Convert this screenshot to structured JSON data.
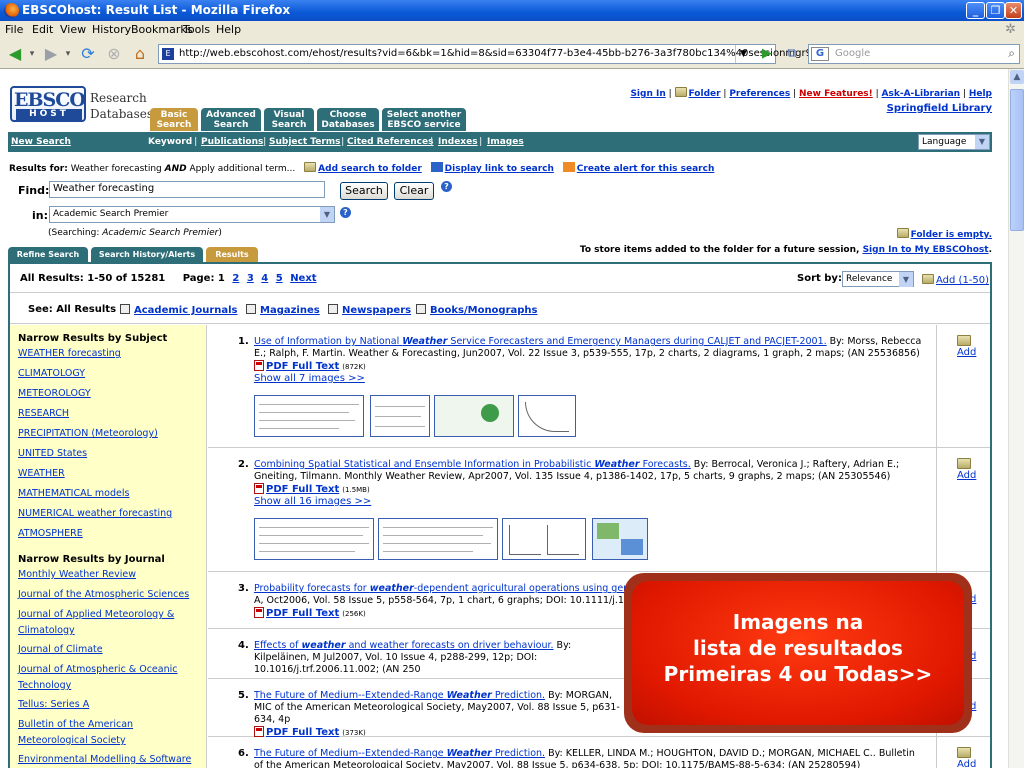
{
  "window": {
    "title": "EBSCOhost: Result List - Mozilla Firefox"
  },
  "menu": [
    "File",
    "Edit",
    "View",
    "History",
    "Bookmarks",
    "Tools",
    "Help"
  ],
  "nav": {
    "url": "http://web.ebscohost.com/ehost/results?vid=6&bk=1&hid=8&sid=63304f77-b3e4-45bb-b276-3a3f780bc134%40sessionmgr9",
    "search_placeholder": "Google"
  },
  "brand": {
    "logo_top": "EBSCO",
    "logo_bottom": "HOST",
    "line1": "Research",
    "line2": "Databases"
  },
  "tabs": [
    {
      "label": "Basic Search"
    },
    {
      "label": "Advanced Search"
    },
    {
      "label": "Visual Search"
    },
    {
      "label": "Choose Databases"
    },
    {
      "label": "Select another EBSCO service"
    }
  ],
  "toplinks": {
    "sign_in": "Sign In",
    "folder": "Folder",
    "preferences": "Preferences",
    "new_features": "New Features!",
    "ask": "Ask-A-Librarian",
    "help": "Help",
    "library": "Springfield Library"
  },
  "greenbar": {
    "new_search": "New Search",
    "keyword": "Keyword",
    "publications": "Publications",
    "subject_terms": "Subject Terms",
    "cited_references": "Cited References",
    "indexes": "Indexes",
    "images": "Images",
    "language": "Language"
  },
  "results_for": {
    "label": "Results for:",
    "query_start": "Weather forecasting",
    "and": "AND",
    "query_end": "Apply additional term...",
    "add_folder": "Add search to folder",
    "display_link": "Display link to search",
    "create_alert": "Create alert for this search"
  },
  "find": {
    "label": "Find:",
    "value": "Weather forecasting",
    "search_button": "Search",
    "clear_button": "Clear"
  },
  "in": {
    "label": "in:",
    "value": "Academic Search Premier",
    "searching_label": "Searching:",
    "searching_value": "Academic Search Premier"
  },
  "folder_status": "Folder is empty.",
  "store": {
    "text": "To store items added to the folder for a future session,",
    "link": "Sign In to My EBSCOhost"
  },
  "result_tabs": [
    "Refine Search",
    "Search History/Alerts",
    "Results"
  ],
  "pagination": {
    "summary": "All Results: 1-50 of 15281",
    "page_label": "Page: 1",
    "pages": [
      "2",
      "3",
      "4",
      "5"
    ],
    "next": "Next"
  },
  "sort": {
    "label": "Sort by:",
    "value": "Relevance",
    "add": "Add (1-50)"
  },
  "see": {
    "label": "See: All Results",
    "types": [
      "Academic Journals",
      "Magazines",
      "Newspapers",
      "Books/Monographs"
    ]
  },
  "sidebar": {
    "subject_heading": "Narrow Results by Subject",
    "subjects": [
      "WEATHER forecasting",
      "CLIMATOLOGY",
      "METEOROLOGY",
      "RESEARCH",
      "PRECIPITATION (Meteorology)",
      "UNITED States",
      "WEATHER",
      "MATHEMATICAL models",
      "NUMERICAL weather forecasting",
      "ATMOSPHERE"
    ],
    "journal_heading": "Narrow Results by Journal",
    "journals": [
      "Monthly Weather Review",
      "Journal of the Atmospheric Sciences",
      "Journal of Applied Meteorology & Climatology",
      "Journal of Climate",
      "Journal of Atmospheric & Oceanic Technology",
      "Tellus: Series A",
      "Bulletin of the American Meteorological Society",
      "Environmental Modelling & Software"
    ]
  },
  "results": [
    {
      "num": "1.",
      "title_a": "Use of Information by National ",
      "title_w": "Weather",
      "title_b": " Service Forecasters and Emergency Managers during CALJET and PACJET-2001.",
      "meta": " By: Morss, Rebecca E.; Ralph, F. Martin. Weather & Forecasting, Jun2007, Vol. 22 Issue 3, p539-555, 17p, 2 charts, 2 diagrams, 1 graph, 2 maps; (AN 25536856)",
      "pdf": "PDF Full Text",
      "size": "(872K)",
      "show": "Show all 7 images >>",
      "add": "Add"
    },
    {
      "num": "2.",
      "title_a": "Combining Spatial Statistical and Ensemble Information in Probabilistic ",
      "title_w": "Weather",
      "title_b": " Forecasts.",
      "meta": " By: Berrocal, Veronica J.; Raftery, Adrian E.; Gneiting, Tilmann. Monthly Weather Review, Apr2007, Vol. 135 Issue 4, p1386-1402, 17p, 5 charts, 9 graphs, 2 maps; (AN 25305546)",
      "pdf": "PDF Full Text",
      "size": "(1.5MB)",
      "show": "Show all 16 images >>",
      "add": "Add"
    },
    {
      "num": "3.",
      "title_a": "Probability forecasts for ",
      "title_w": "weather",
      "title_b": "-dependent agricultural operations using generali",
      "meta": "A, Oct2006, Vol. 58 Issue 5, p558-564, 7p, 1 chart, 6 graphs; DOI: 10.1111/j.160",
      "pdf": "PDF Full Text",
      "size": "(256K)",
      "add": "Add"
    },
    {
      "num": "4.",
      "title_a": "Effects of ",
      "title_w": "weather",
      "title_b": " and weather forecasts on driver behaviour.",
      "meta": " By: Kilpeläinen, M Jul2007, Vol. 10 Issue 4, p288-299, 12p; DOI: 10.1016/j.trf.2006.11.002; (AN 250",
      "add": "Add"
    },
    {
      "num": "5.",
      "title_a": "The Future of Medium--Extended-Range ",
      "title_w": "Weather",
      "title_b": " Prediction.",
      "meta": " By: MORGAN, MIC of the American Meteorological Society, May2007, Vol. 88 Issue 5, p631-634, 4p",
      "pdf": "PDF Full Text",
      "size": "(373K)",
      "add": "Add"
    },
    {
      "num": "6.",
      "title_a": "The Future of Medium--Extended-Range ",
      "title_w": "Weather",
      "title_b": " Prediction.",
      "meta": " By: KELLER, LINDA M.; HOUGHTON, DAVID D.; MORGAN, MICHAEL C.. Bulletin of the American Meteorological Society, May2007, Vol. 88 Issue 5, p634-638, 5p; DOI: 10.1175/BAMS-88-5-634; (AN 25280594)",
      "add": "Add"
    }
  ],
  "callout": {
    "line1": "Imagens na",
    "line2": "lista de resultados",
    "line3": "Primeiras 4 ou Todas>>"
  }
}
